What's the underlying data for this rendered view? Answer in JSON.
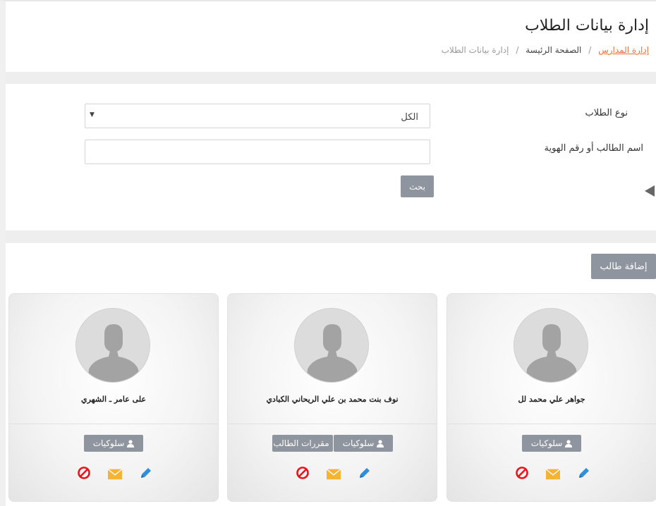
{
  "header": {
    "title": "إدارة بيانات الطلاب",
    "breadcrumb": {
      "link": "إدارة المدارس",
      "home": "الصفحة الرئيسة",
      "current": "إدارة بيانات الطلاب",
      "separator": "/"
    }
  },
  "filters": {
    "type_label": "نوع الطلاب",
    "type_value": "الكل",
    "name_label": "اسم الطالب أو رقم الهوية",
    "name_value": "",
    "name_placeholder": "",
    "search_button": "بحث"
  },
  "actions": {
    "add_student": "إضافة طالب"
  },
  "students": [
    {
      "name": "جواهر علي محمد لل",
      "behaviors_label": "سلوكيات"
    },
    {
      "name": "نوف بنت محمد بن علي الريحاني الكبادي",
      "behaviors_label": "سلوكيات",
      "courses_label": "مقررات الطالب"
    },
    {
      "name": "على عامر ـ الشهري",
      "behaviors_label": "سلوكيات"
    }
  ],
  "colors": {
    "accent_link": "#e8703a",
    "button_gray": "#8f959f",
    "ban_red": "#e8141c",
    "mail_orange": "#f5b335",
    "edit_blue": "#2f8fd8"
  },
  "icons": [
    "user-icon",
    "book-icon",
    "ban-icon",
    "mail-icon",
    "pencil-icon",
    "avatar-silhouette-icon"
  ]
}
